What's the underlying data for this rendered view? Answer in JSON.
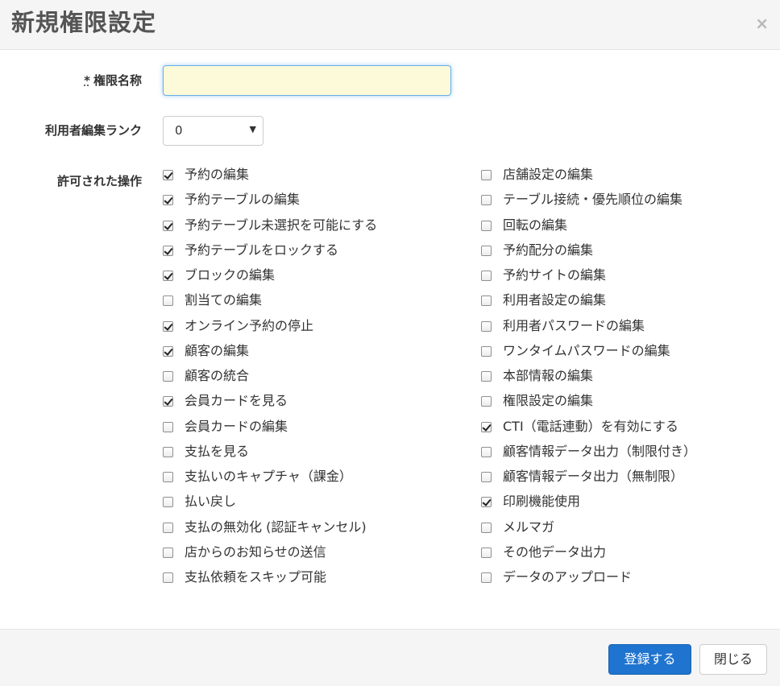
{
  "dialog": {
    "title": "新規権限設定",
    "close_symbol": "×"
  },
  "form": {
    "name": {
      "required_mark": "*",
      "label": "権限名称",
      "value": ""
    },
    "rank": {
      "label": "利用者編集ランク",
      "value": "0"
    },
    "permissions_label": "許可された操作"
  },
  "permissions": {
    "left": [
      {
        "label": "予約の編集",
        "checked": true
      },
      {
        "label": "予約テーブルの編集",
        "checked": true
      },
      {
        "label": "予約テーブル未選択を可能にする",
        "checked": true
      },
      {
        "label": "予約テーブルをロックする",
        "checked": true
      },
      {
        "label": "ブロックの編集",
        "checked": true
      },
      {
        "label": "割当ての編集",
        "checked": false
      },
      {
        "label": "オンライン予約の停止",
        "checked": true
      },
      {
        "label": "顧客の編集",
        "checked": true
      },
      {
        "label": "顧客の統合",
        "checked": false
      },
      {
        "label": "会員カードを見る",
        "checked": true
      },
      {
        "label": "会員カードの編集",
        "checked": false
      },
      {
        "label": "支払を見る",
        "checked": false
      },
      {
        "label": "支払いのキャプチャ（課金）",
        "checked": false
      },
      {
        "label": "払い戻し",
        "checked": false
      },
      {
        "label": "支払の無効化 (認証キャンセル)",
        "checked": false
      },
      {
        "label": "店からのお知らせの送信",
        "checked": false
      },
      {
        "label": "支払依頼をスキップ可能",
        "checked": false
      }
    ],
    "right": [
      {
        "label": "店舗設定の編集",
        "checked": false
      },
      {
        "label": "テーブル接続・優先順位の編集",
        "checked": false
      },
      {
        "label": "回転の編集",
        "checked": false
      },
      {
        "label": "予約配分の編集",
        "checked": false
      },
      {
        "label": "予約サイトの編集",
        "checked": false
      },
      {
        "label": "利用者設定の編集",
        "checked": false
      },
      {
        "label": "利用者パスワードの編集",
        "checked": false
      },
      {
        "label": "ワンタイムパスワードの編集",
        "checked": false
      },
      {
        "label": "本部情報の編集",
        "checked": false
      },
      {
        "label": "権限設定の編集",
        "checked": false
      },
      {
        "label": "CTI（電話連動）を有効にする",
        "checked": true
      },
      {
        "label": "顧客情報データ出力（制限付き）",
        "checked": false
      },
      {
        "label": "顧客情報データ出力（無制限）",
        "checked": false
      },
      {
        "label": "印刷機能使用",
        "checked": true
      },
      {
        "label": "メルマガ",
        "checked": false
      },
      {
        "label": "その他データ出力",
        "checked": false
      },
      {
        "label": "データのアップロード",
        "checked": false
      }
    ]
  },
  "footer": {
    "register_label": "登録する",
    "close_label": "閉じる"
  },
  "colors": {
    "primary": "#1f74cf",
    "input_bg": "#fcfad8",
    "header_bg": "#f5f5f5"
  }
}
